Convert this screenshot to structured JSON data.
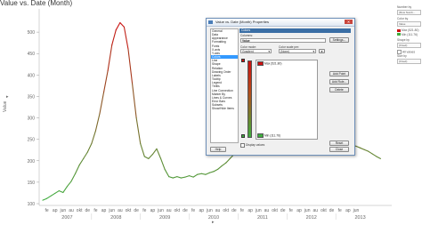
{
  "chart_data": {
    "type": "line",
    "title": "Value vs. Date (Month)",
    "ylabel": "Value",
    "ylim": [
      100,
      550
    ],
    "yticks": [
      100,
      150,
      200,
      250,
      300,
      350,
      400,
      450,
      500
    ],
    "xlim": [
      0,
      84
    ],
    "month_ticks": [
      "fe",
      "ap",
      "jun",
      "au",
      "okt",
      "de",
      "fe",
      "ap",
      "jun",
      "au",
      "okt",
      "de",
      "fe",
      "ap",
      "jun",
      "au",
      "okt",
      "de",
      "fe",
      "ap",
      "jun",
      "au",
      "okt",
      "de",
      "fe",
      "ap",
      "jun",
      "au",
      "okt",
      "de",
      "fe",
      "ap",
      "jun",
      "au",
      "okt",
      "de",
      "fe",
      "ap",
      "jun"
    ],
    "years": [
      "2007",
      "2008",
      "2009",
      "2010",
      "2011",
      "2012",
      "2013"
    ],
    "series": [
      {
        "values": [
          [
            0,
            108
          ],
          [
            1,
            112
          ],
          [
            2,
            118
          ],
          [
            3,
            124
          ],
          [
            4,
            130
          ],
          [
            5,
            126
          ],
          [
            6,
            140
          ],
          [
            7,
            152
          ],
          [
            8,
            170
          ],
          [
            9,
            190
          ],
          [
            10,
            205
          ],
          [
            11,
            220
          ],
          [
            12,
            240
          ],
          [
            13,
            270
          ],
          [
            14,
            310
          ],
          [
            15,
            360
          ],
          [
            16,
            410
          ],
          [
            17,
            470
          ],
          [
            18,
            505
          ],
          [
            19,
            522
          ],
          [
            20,
            512
          ],
          [
            21,
            460
          ],
          [
            22,
            380
          ],
          [
            23,
            300
          ],
          [
            24,
            240
          ],
          [
            25,
            210
          ],
          [
            26,
            205
          ],
          [
            27,
            215
          ],
          [
            28,
            228
          ],
          [
            29,
            205
          ],
          [
            30,
            180
          ],
          [
            31,
            163
          ],
          [
            32,
            160
          ],
          [
            33,
            163
          ],
          [
            34,
            160
          ],
          [
            35,
            162
          ],
          [
            36,
            165
          ],
          [
            37,
            162
          ],
          [
            38,
            168
          ],
          [
            39,
            170
          ],
          [
            40,
            168
          ],
          [
            41,
            172
          ],
          [
            42,
            175
          ],
          [
            43,
            180
          ],
          [
            44,
            188
          ],
          [
            45,
            195
          ],
          [
            46,
            205
          ],
          [
            47,
            215
          ],
          [
            48,
            222
          ],
          [
            49,
            230
          ],
          [
            50,
            236
          ],
          [
            51,
            240
          ],
          [
            52,
            242
          ],
          [
            53,
            244
          ],
          [
            54,
            243
          ],
          [
            55,
            245
          ],
          [
            56,
            247
          ],
          [
            57,
            250
          ],
          [
            58,
            255
          ],
          [
            59,
            258
          ],
          [
            60,
            262
          ],
          [
            61,
            268
          ],
          [
            62,
            272
          ],
          [
            63,
            270
          ],
          [
            64,
            266
          ],
          [
            65,
            262
          ],
          [
            66,
            258
          ],
          [
            67,
            255
          ],
          [
            68,
            252
          ],
          [
            69,
            250
          ],
          [
            70,
            248
          ],
          [
            71,
            246
          ],
          [
            72,
            244
          ],
          [
            73,
            242
          ],
          [
            74,
            240
          ],
          [
            75,
            238
          ],
          [
            76,
            236
          ],
          [
            77,
            234
          ],
          [
            78,
            230
          ],
          [
            79,
            226
          ],
          [
            80,
            222
          ],
          [
            81,
            216
          ],
          [
            82,
            210
          ],
          [
            83,
            205
          ]
        ],
        "color_max": "#cc1111",
        "color_min": "#3fae3f"
      }
    ]
  },
  "sidebar": {
    "number_by": "Number by",
    "number_by_value": "(Row Numb...",
    "color_by": "Color by",
    "color_by_value": "Value",
    "legend_max": "Max (521.80)",
    "legend_min": "Min (111.76)",
    "shape_by": "Shape by",
    "shape_by_value": "(Fixed)",
    "all_values": "All values",
    "size_by": "Size by",
    "size_by_value": "(Fixed)"
  },
  "dialog": {
    "title": "Value vs. Date (Month) Properties",
    "close_glyph": "✕",
    "nav_items": [
      "General",
      "Data",
      "Appearance",
      "Formatting",
      "Fonts",
      "X-axis",
      "Y-axis",
      "Colors",
      "Line",
      "Shape",
      "Relation",
      "Drawing Order",
      "Labels",
      "Tooltip",
      "Legend",
      "Trellis",
      "Line Connection",
      "Marker By",
      "Lines & Curves",
      "Error Bars",
      "Subsets",
      "Show/Hide Items"
    ],
    "selected_nav": 7,
    "header": "Colors",
    "columns_label": "Columns:",
    "columns_value": "Value",
    "settings_button": "Settings...",
    "color_mode_label": "Color mode:",
    "color_mode_value": "Gradient",
    "scale_label": "Color scale per:",
    "scale_value": "(None)",
    "stop_max": "Max (521.80)",
    "stop_min": "Min (111.76)",
    "add_point": "Add Point",
    "add_rule": "Add Rule...",
    "delete_button": "Delete",
    "display_values": "Display values",
    "reset_button": "Reset",
    "help_button": "Help",
    "close_button": "Close",
    "accent": "#3399ff"
  }
}
